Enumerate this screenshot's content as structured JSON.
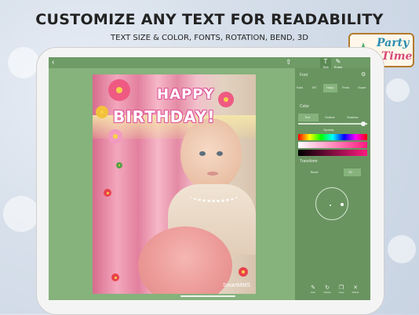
{
  "headline": "CUSTOMIZE ANY TEXT FOR READABILITY",
  "subline": "TEXT SIZE & COLOR, FONTS, ROTATION, BEND, 3D",
  "logo": {
    "line1": "Party",
    "line2": "Time"
  },
  "app": {
    "topbar": {
      "back_icon": "chevron-left-icon",
      "share_icon": "share-icon",
      "tab_text": {
        "label": "Text",
        "glyph": "T"
      },
      "tab_edit": {
        "label": "Erase",
        "glyph": "✎"
      }
    },
    "card": {
      "line1": "HAPPY",
      "line2": "BIRTHDAY!",
      "watermark": "SmartMMS"
    },
    "panel": {
      "title": "Font",
      "fonts": [
        "Kalo",
        "MT",
        "Happ",
        "Frosi",
        "Super"
      ],
      "selected_font": "Happ",
      "color_title": "Color",
      "color_modes": [
        "Text",
        "Outline",
        "Shadow"
      ],
      "opacity_label": "Opacity",
      "transform_title": "Transform",
      "transform_modes": [
        "Bend",
        "3D"
      ],
      "tools": [
        {
          "label": "Edit",
          "icon": "edit-icon"
        },
        {
          "label": "Rotate",
          "icon": "rotate-icon"
        },
        {
          "label": "Copy",
          "icon": "copy-icon"
        },
        {
          "label": "Delete",
          "icon": "trash-icon"
        }
      ]
    }
  },
  "colors": {
    "screen_bg": "#86b27c",
    "panel_bg": "#699460",
    "accent_pink": "#e0579a",
    "logo_blue": "#2a8db0",
    "logo_pink": "#d84a7a"
  }
}
